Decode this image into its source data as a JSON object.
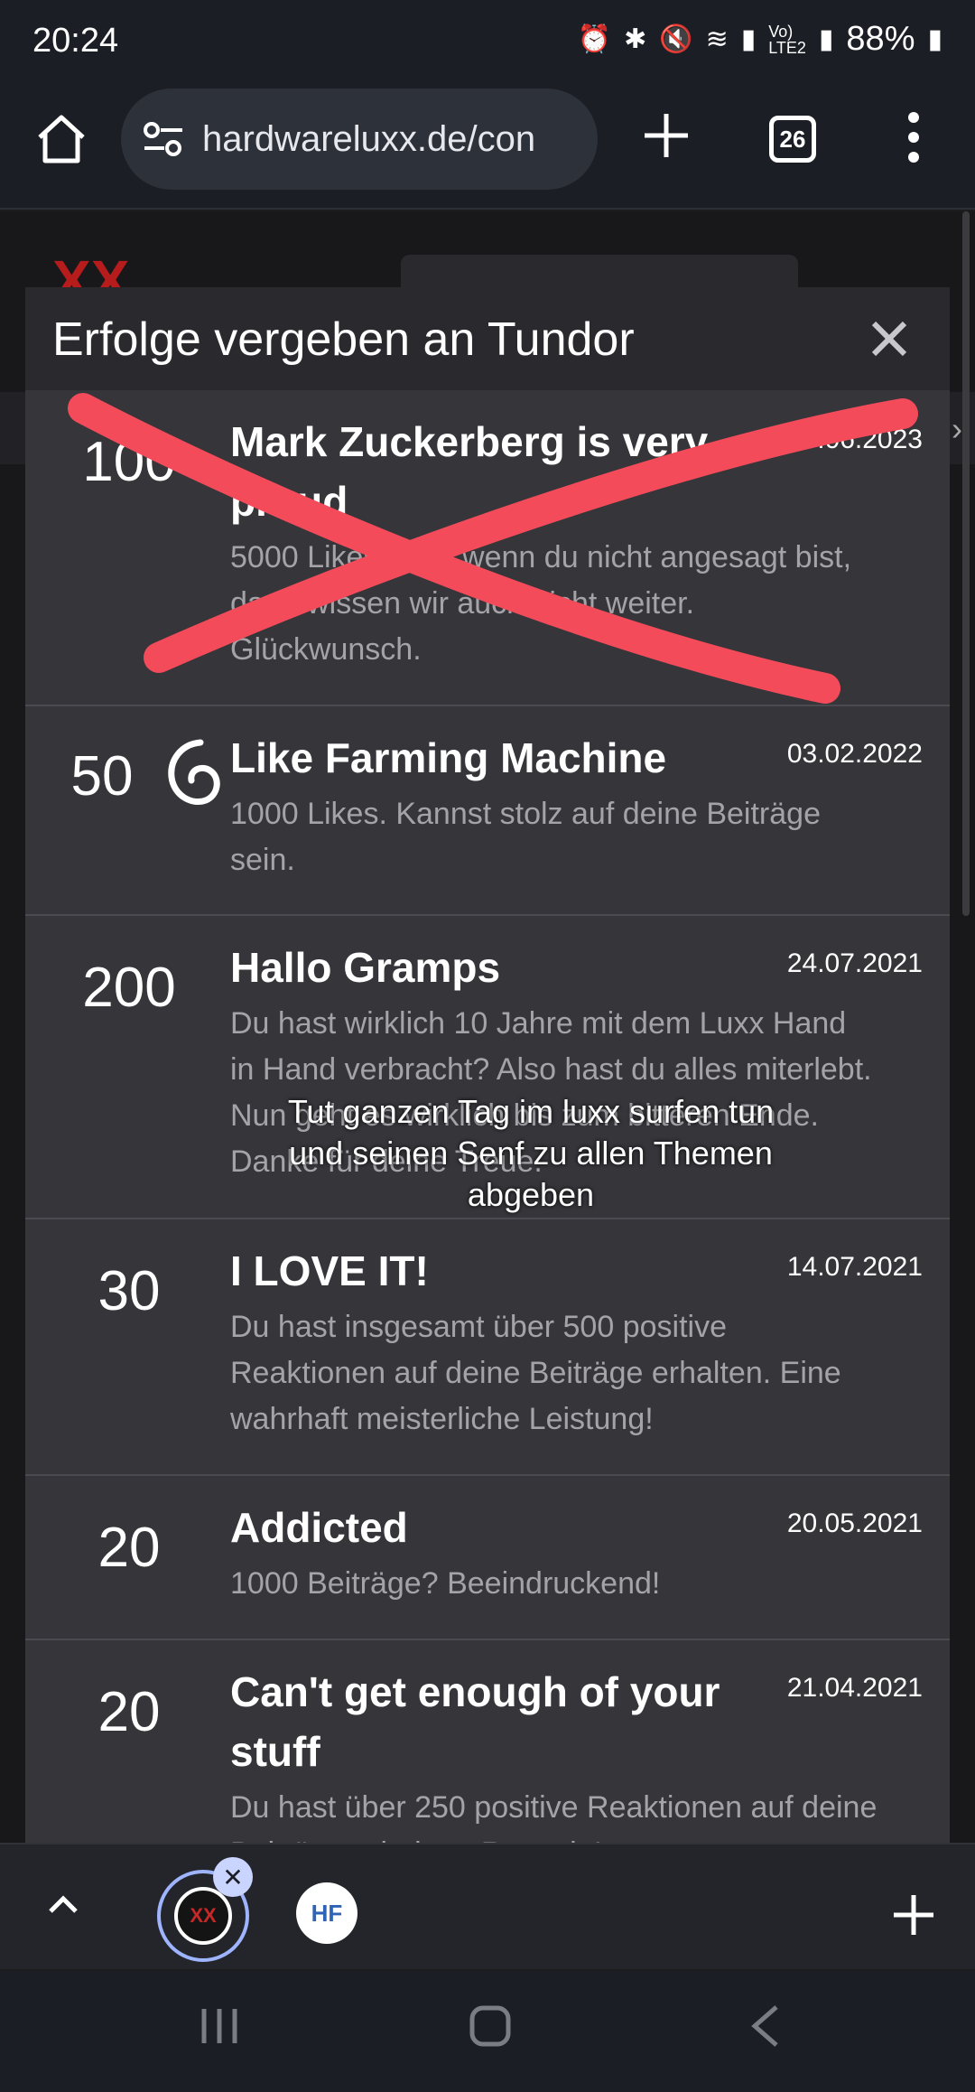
{
  "status": {
    "time": "20:24",
    "battery": "88%",
    "icons": [
      "alarm-icon",
      "bluetooth-icon",
      "mute-icon",
      "wifi-icon",
      "signal-icon",
      "volte-icon",
      "signal-icon",
      "battery-icon"
    ]
  },
  "browser": {
    "url": "hardwareluxx.de/con",
    "tab_count": "26"
  },
  "dialog": {
    "title": "Erfolge vergeben an Tundor",
    "items": [
      {
        "points": "100",
        "name_line1": "Mark Zuckerberg is very",
        "name_line2": "proud",
        "date": "15.06.2023",
        "desc_lines": [
          "5000 Likes. Also wenn du nicht angesagt bist,",
          "dann wissen wir auch nicht weiter.",
          "Glückwunsch."
        ]
      },
      {
        "points": "50",
        "name_line1": "Like Farming Machine",
        "date": "03.02.2022",
        "desc_lines": [
          "1000 Likes. Kannst stolz auf deine Beiträge",
          "sein."
        ]
      },
      {
        "points": "200",
        "name_line1": "Hallo Gramps",
        "date": "24.07.2021",
        "desc_lines": [
          "Du hast wirklich 10 Jahre mit dem Luxx Hand",
          "in Hand verbracht? Also hast du alles miterlebt.",
          "Nun geht es wirklich bis zum bitteren Ende.",
          "Danke für deine Treue."
        ]
      },
      {
        "points": "30",
        "name_line1": "I LOVE IT!",
        "date": "14.07.2021",
        "desc_lines": [
          "Du hast insgesamt über 500 positive",
          "Reaktionen auf deine Beiträge erhalten. Eine",
          "wahrhaft meisterliche Leistung!"
        ]
      },
      {
        "points": "20",
        "name_line1": "Addicted",
        "date": "20.05.2021",
        "desc_lines": [
          "1000 Beiträge? Beeindruckend!"
        ]
      },
      {
        "points": "20",
        "name_line1": "Can't get enough of your",
        "name_line2": "stuff",
        "date": "21.04.2021",
        "desc_lines": [
          "Du hast über 250 positive Reaktionen auf deine",
          "Beiträge erhalten. Respekt!"
        ]
      }
    ],
    "tooltip_lines": [
      "Tut ganzen Tag im luxx surfen tun",
      "und seinen Senf zu allen Themen",
      "abgeben"
    ]
  },
  "bottom_tabs": {
    "tab1_label": "XX",
    "tab2_label": "HF"
  },
  "colors": {
    "cross": "#f44b5a",
    "accent": "#9fb4ff"
  }
}
